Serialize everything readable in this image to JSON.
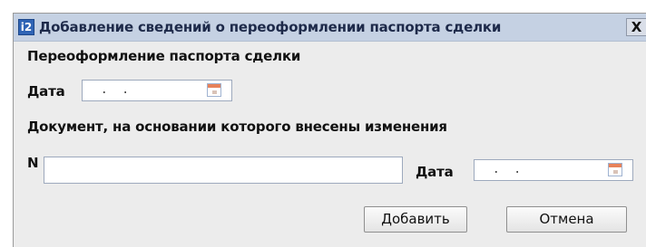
{
  "window": {
    "title": "Добавление  сведений о переоформлении паспорта сделки",
    "app_icon": "i2",
    "close_symbol": "X"
  },
  "form": {
    "section1_heading": "Переоформление паспорта сделки",
    "date_label": "Дата",
    "date_value": " .  .",
    "section2_heading": "Документ, на основании которого внесены изменения",
    "number_label": "N",
    "number_value": "",
    "doc_date_label": "Дата",
    "doc_date_value": " .  ."
  },
  "buttons": {
    "add": "Добавить",
    "cancel": "Отмена"
  },
  "icons": {
    "app": "app-logo-icon",
    "calendar": "calendar-icon",
    "close": "close-icon"
  },
  "colors": {
    "titlebar": "#c5d1e3",
    "window_bg": "#ececec",
    "calendar_accent": "#e7825a"
  }
}
